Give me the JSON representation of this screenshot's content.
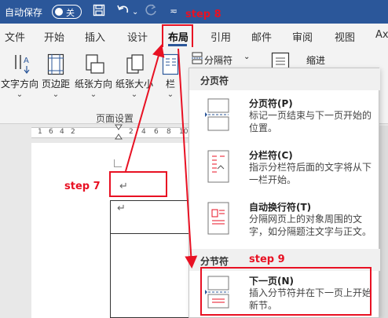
{
  "titlebar": {
    "autosave_label": "自动保存",
    "autosave_state": "关",
    "step_label": "step 8"
  },
  "tabs": [
    {
      "label": "文件",
      "active": false
    },
    {
      "label": "开始",
      "active": false
    },
    {
      "label": "插入",
      "active": false
    },
    {
      "label": "设计",
      "active": false
    },
    {
      "label": "布局",
      "active": true
    },
    {
      "label": "引用",
      "active": false
    },
    {
      "label": "邮件",
      "active": false
    },
    {
      "label": "审阅",
      "active": false
    },
    {
      "label": "视图",
      "active": false
    },
    {
      "label": "Ax",
      "active": false
    }
  ],
  "ribbon": {
    "buttons": [
      {
        "label": "文字方向",
        "icon": "text-direction-icon"
      },
      {
        "label": "页边距",
        "icon": "margins-icon"
      },
      {
        "label": "纸张方向",
        "icon": "orientation-icon"
      },
      {
        "label": "纸张大小",
        "icon": "size-icon"
      },
      {
        "label": "栏",
        "icon": "columns-icon"
      }
    ],
    "group_label": "页面设置",
    "breaks_label": "分隔符",
    "indent_label": "缩进"
  },
  "document": {
    "step7_label": "step 7",
    "paragraph_mark": "↵"
  },
  "breaks_menu": {
    "page_breaks_header": "分页符",
    "section_breaks_header": "分节符",
    "step9_label": "step 9",
    "items": [
      {
        "title": "分页符(P)",
        "desc": "标记一页结束与下一页开始的位置。",
        "icon": "page-break-icon"
      },
      {
        "title": "分栏符(C)",
        "desc": "指示分栏符后面的文字将从下一栏开始。",
        "icon": "column-break-icon"
      },
      {
        "title": "自动换行符(T)",
        "desc": "分隔网页上的对象周围的文字，如分隔题注文字与正文。",
        "icon": "text-wrapping-icon"
      },
      {
        "title": "下一页(N)",
        "desc": "插入分节符并在下一页上开始新节。",
        "icon": "next-page-icon"
      }
    ]
  },
  "colors": {
    "title_bar": "#2b579a",
    "annotation_red": "#e81123"
  }
}
